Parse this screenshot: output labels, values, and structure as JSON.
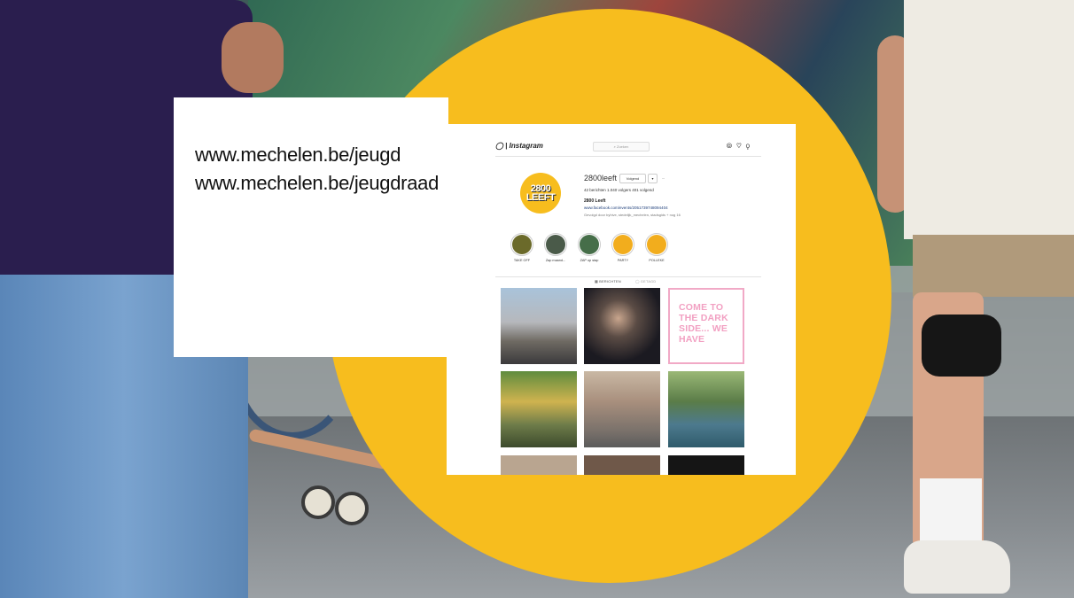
{
  "urls": {
    "line1": "www.mechelen.be/jeugd",
    "line2": "www.mechelen.be/jeugdraad"
  },
  "colors": {
    "circle": "#f7bd1e",
    "card": "#ffffff",
    "tile_pink": "#f2a0c2"
  },
  "instagram": {
    "brand": "Instagram",
    "search_placeholder": "Zoeken",
    "nav_icons": [
      "compass-icon",
      "heart-icon",
      "user-icon"
    ],
    "profile_pic_text": [
      "2800",
      "LEEFT"
    ],
    "username": "2800leeft",
    "follow_button": "Volgend",
    "more_button": "...",
    "stats": "42 berichten   1.040 volgers   401 volgend",
    "bio_name": "2800 Leeft",
    "bio_link": "www.facebook.com/events/2051739748094404",
    "bio_followed_by": "Gevolgd door byhive, stedelijk_mechelen, stadsgids + nog 16",
    "highlights": [
      "TAKE OFF",
      "Zap maand...",
      "ZAP op stap",
      "PARTY",
      "POLLEKE"
    ],
    "tabs": [
      "BERICHTEN",
      "GETAGD"
    ],
    "tile_text": "COME TO THE DARK SIDE... WE HAVE"
  }
}
